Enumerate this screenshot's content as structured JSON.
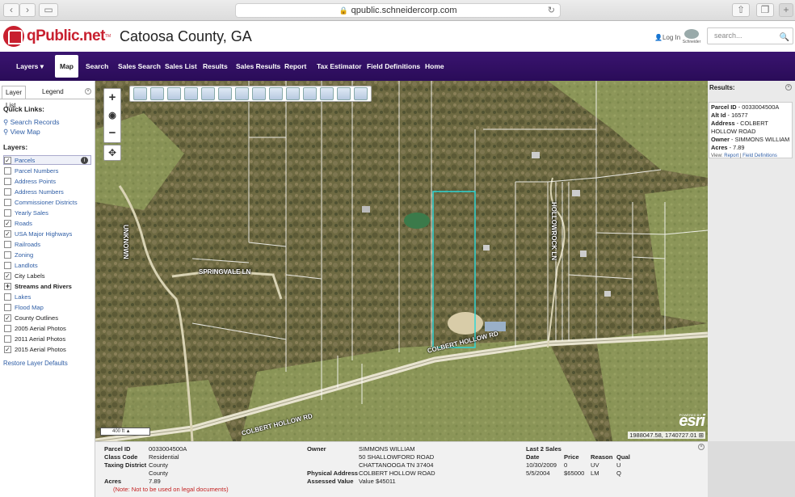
{
  "browser": {
    "url": "qpublic.schneidercorp.com"
  },
  "header": {
    "logo_text": "qPublic.net",
    "trademark": "TM",
    "county": "Catoosa County, GA",
    "login": "Log In",
    "schneider": "Schneider",
    "search_placeholder": "search..."
  },
  "nav": {
    "items": [
      {
        "label": "Layers ▾",
        "active": false
      },
      {
        "label": "Map",
        "active": true
      },
      {
        "label": "Search",
        "active": false
      },
      {
        "label": "Sales Search",
        "active": false
      },
      {
        "label": "Sales List",
        "active": false
      },
      {
        "label": "Results",
        "active": false
      },
      {
        "label": "Sales Results",
        "active": false
      },
      {
        "label": "Report",
        "active": false
      },
      {
        "label": "Tax Estimator",
        "active": false
      },
      {
        "label": "Field Definitions",
        "active": false
      },
      {
        "label": "Home",
        "active": false
      }
    ]
  },
  "sidebar": {
    "tabs": [
      "Layer List",
      "Legend"
    ],
    "quick_links_title": "Quick Links:",
    "quick_links": [
      "Search Records",
      "View Map"
    ],
    "layers_title": "Layers:",
    "layers": [
      {
        "label": "Parcels",
        "checked": true
      },
      {
        "label": "Parcel Numbers",
        "checked": false
      },
      {
        "label": "Address Points",
        "checked": false
      },
      {
        "label": "Address Numbers",
        "checked": false
      },
      {
        "label": "Commissioner Districts",
        "checked": false
      },
      {
        "label": "Yearly Sales",
        "checked": false
      },
      {
        "label": "Roads",
        "checked": true
      },
      {
        "label": "USA Major Highways",
        "checked": true
      },
      {
        "label": "Railroads",
        "checked": false
      },
      {
        "label": "Zoning",
        "checked": false
      },
      {
        "label": "Landlots",
        "checked": false
      },
      {
        "label": "City Labels",
        "checked": true
      },
      {
        "label": "Streams and Rivers",
        "checked": false
      },
      {
        "label": "Lakes",
        "checked": false
      },
      {
        "label": "Flood Map",
        "checked": false
      },
      {
        "label": "County Outlines",
        "checked": true
      },
      {
        "label": "2005 Aerial Photos",
        "checked": false
      },
      {
        "label": "2011 Aerial Photos",
        "checked": false
      },
      {
        "label": "2015 Aerial Photos",
        "checked": true
      }
    ],
    "restore": "Restore Layer Defaults"
  },
  "map": {
    "road_labels": [
      "UNKNOWN",
      "SPRINGVALE LN",
      "HOLLOWROCK LN",
      "COLBERT HOLLOW RD",
      "COLBERT HOLLOW RD"
    ],
    "scale": "400 ft",
    "coords": "1988047.58, 1740727.01",
    "esri_powered": "POWERED BY",
    "esri": "esri"
  },
  "results": {
    "title": "Results:",
    "parcel_id_label": "Parcel ID",
    "parcel_id": "0033004500A",
    "alt_id_label": "Alt Id",
    "alt_id": "16577",
    "address_label": "Address",
    "address": "COLBERT HOLLOW ROAD",
    "owner_label": "Owner",
    "owner": "SIMMONS WILLIAM",
    "acres_label": "Acres",
    "acres": "7.89",
    "view_label": "View:",
    "view_report": "Report",
    "view_fields": "Field Definitions"
  },
  "details": {
    "parcel_id_label": "Parcel ID",
    "parcel_id": "0033004500A",
    "class_code_label": "Class Code",
    "class_code": "Residential",
    "taxing_district_label": "Taxing District",
    "taxing_district": "County",
    "taxing_district_2": "County",
    "acres_label": "Acres",
    "acres": "7.89",
    "note": "(Note: Not to be used on legal documents)",
    "owner_label": "Owner",
    "owner_lines": [
      "SIMMONS WILLIAM",
      "50 SHALLOWFORD ROAD",
      "CHATTANOOGA TN 37404"
    ],
    "physical_address_label": "Physical Address",
    "physical_address": "COLBERT HOLLOW ROAD",
    "assessed_value_label": "Assessed Value",
    "assessed_value": "Value $45011",
    "sales_title": "Last 2 Sales",
    "sales_headers": [
      "Date",
      "Price",
      "Reason",
      "Qual"
    ],
    "sales_rows": [
      [
        "10/30/2009",
        "0",
        "UV",
        "U"
      ],
      [
        "5/5/2004",
        "$65000",
        "LM",
        "Q"
      ]
    ]
  }
}
